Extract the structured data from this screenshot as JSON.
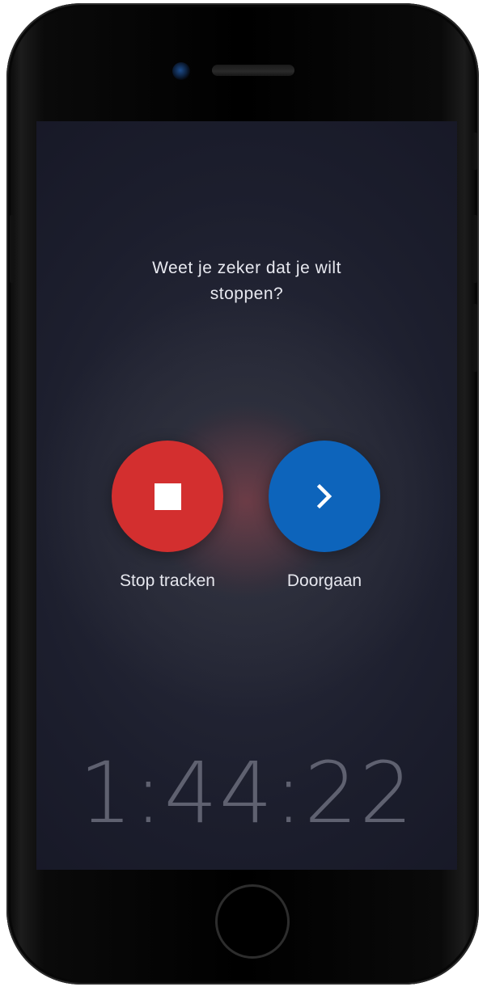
{
  "dialog": {
    "question_line1": "Weet je zeker dat je wilt",
    "question_line2": "stoppen?"
  },
  "actions": {
    "stop": {
      "label": "Stop tracken",
      "icon": "stop-icon",
      "color": "#d32f2f"
    },
    "resume": {
      "label": "Doorgaan",
      "icon": "chevron-right-icon",
      "color": "#0d64bb"
    }
  },
  "timer": {
    "elapsed": "1:44:22"
  }
}
